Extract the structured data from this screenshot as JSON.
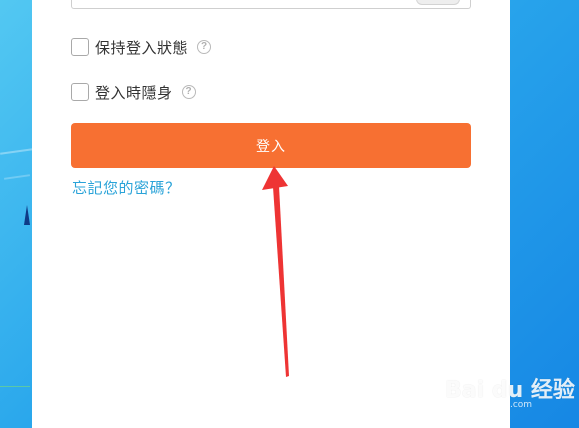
{
  "options": {
    "keep_logged_in_label": "保持登入狀態",
    "invisible_login_label": "登入時隱身",
    "help_glyph": "?"
  },
  "login_button_label": "登入",
  "forgot_password_link": "忘記您的密碼？",
  "colors": {
    "login_button": "#f77032",
    "link": "#2aa3d8",
    "arrow": "#ee3434",
    "panel": "#ffffff"
  },
  "icons": [
    "help-icon",
    "annotation-arrow",
    "baidu-paw-logo"
  ],
  "watermark": {
    "logo_text": "Bai du 经验",
    "url": "jingyan.baidu.com"
  }
}
